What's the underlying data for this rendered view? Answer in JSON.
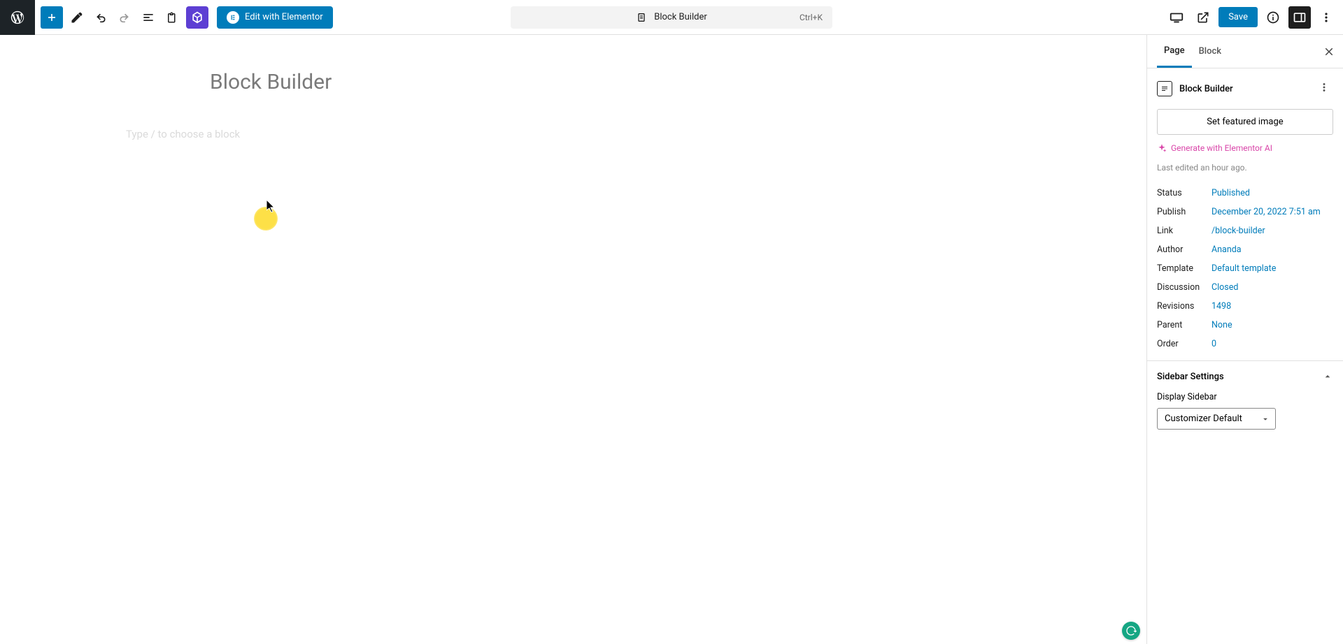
{
  "toolbar": {
    "edit_elementor_label": "Edit with Elementor",
    "center_title": "Block Builder",
    "shortcut": "Ctrl+K",
    "save_label": "Save"
  },
  "canvas": {
    "page_title": "Block Builder",
    "placeholder": "Type / to choose a block"
  },
  "sidebar": {
    "tabs": {
      "page": "Page",
      "block": "Block"
    },
    "document_title": "Block Builder",
    "featured_image_btn": "Set featured image",
    "ai_link": "Generate with Elementor AI",
    "last_edited": "Last edited an hour ago.",
    "meta": {
      "status": {
        "label": "Status",
        "value": "Published"
      },
      "publish": {
        "label": "Publish",
        "value": "December 20, 2022 7:51 am"
      },
      "link": {
        "label": "Link",
        "value": "/block-builder"
      },
      "author": {
        "label": "Author",
        "value": "Ananda"
      },
      "template": {
        "label": "Template",
        "value": "Default template"
      },
      "discussion": {
        "label": "Discussion",
        "value": "Closed"
      },
      "revisions": {
        "label": "Revisions",
        "value": "1498"
      },
      "parent": {
        "label": "Parent",
        "value": "None"
      },
      "order": {
        "label": "Order",
        "value": "0"
      }
    },
    "sidebar_settings": {
      "panel_title": "Sidebar Settings",
      "display_label": "Display Sidebar",
      "display_value": "Customizer Default"
    }
  }
}
